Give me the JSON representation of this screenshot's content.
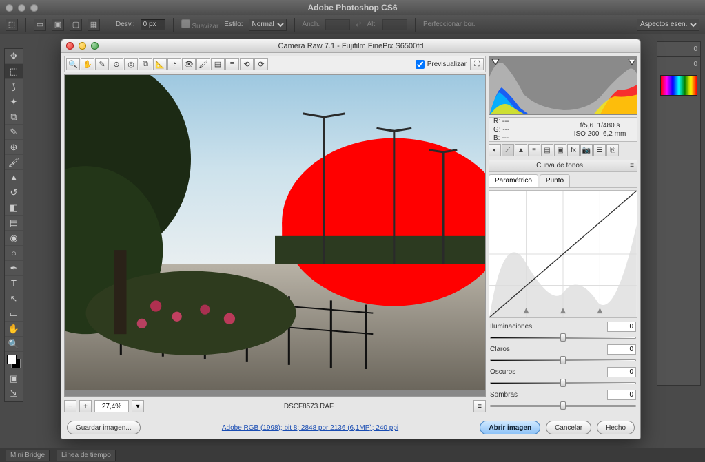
{
  "app": {
    "title": "Adobe Photoshop CS6"
  },
  "options": {
    "desv_label": "Desv.:",
    "desv_value": "0 px",
    "suavizar": "Suavizar",
    "estilo_label": "Estilo:",
    "estilo_value": "Normal",
    "anch_label": "Anch.",
    "alt_label": "Alt.",
    "perfeccionar": "Perfeccionar bor.",
    "workspace": "Aspectos esen."
  },
  "status": {
    "mini_bridge": "Mini Bridge",
    "timeline": "Línea de tiempo"
  },
  "camera_raw": {
    "title": "Camera Raw 7.1  -  Fujifilm FinePix S6500fd",
    "preview_label": "Previsualizar",
    "zoom_value": "27,4%",
    "filename": "DSCF8573.RAF",
    "save_image": "Guardar imagen...",
    "profile_link": "Adobe RGB (1998); bit 8; 2848 por 2136 (6,1MP); 240 ppi",
    "open_image": "Abrir imagen",
    "cancel": "Cancelar",
    "done": "Hecho",
    "exif": {
      "r_label": "R:",
      "r_value": "---",
      "g_label": "G:",
      "g_value": "---",
      "b_label": "B:",
      "b_value": "---",
      "aperture": "f/5,6",
      "shutter": "1/480 s",
      "iso": "ISO 200",
      "focal": "6,2 mm"
    },
    "panel_title": "Curva de tonos",
    "subtabs": {
      "parametrico": "Paramétrico",
      "punto": "Punto"
    },
    "sliders": {
      "iluminaciones": {
        "label": "Iluminaciones",
        "value": "0"
      },
      "claros": {
        "label": "Claros",
        "value": "0"
      },
      "oscuros": {
        "label": "Oscuros",
        "value": "0"
      },
      "sombras": {
        "label": "Sombras",
        "value": "0"
      }
    }
  },
  "right_values": {
    "v1": "0",
    "v2": "0"
  }
}
